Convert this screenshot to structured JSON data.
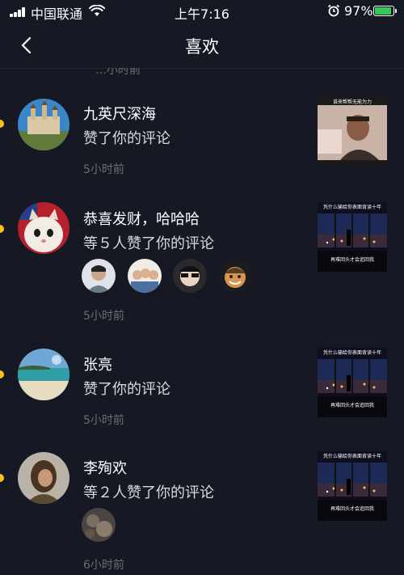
{
  "status_bar": {
    "carrier": "中国联通",
    "time": "上午7:16",
    "battery": "97%",
    "battery_level": 0.97
  },
  "nav": {
    "title": "喜欢",
    "back_icon": "chevron-left-icon"
  },
  "previous_time": "…小时前",
  "items": [
    {
      "name": "九英尺深海",
      "action": "赞了你的评论",
      "time": "5小时前",
      "thumb_caption": "谁来帮帮无能为力"
    },
    {
      "name": "恭喜发财，哈哈哈",
      "action": "等５人赞了你的评论",
      "time": "5小时前",
      "thumb_caption": "凭什么输给你表面背读十年",
      "thumb_sub": "再难回头才会追回我"
    },
    {
      "name": "张亮",
      "action": "赞了你的评论",
      "time": "5小时前",
      "thumb_caption": "凭什么输给你表面背读十年",
      "thumb_sub": "再难回头才会追回我"
    },
    {
      "name": "李殉欢",
      "action": "等２人赞了你的评论",
      "time": "6小时前",
      "thumb_caption": "凭什么输给你表面背读十年",
      "thumb_sub": "再难回头才会追回我"
    }
  ],
  "colors": {
    "background": "#161823",
    "unread_dot": "#f7c21c",
    "secondary_text": "#6b6d75",
    "battery": "#35c759"
  }
}
